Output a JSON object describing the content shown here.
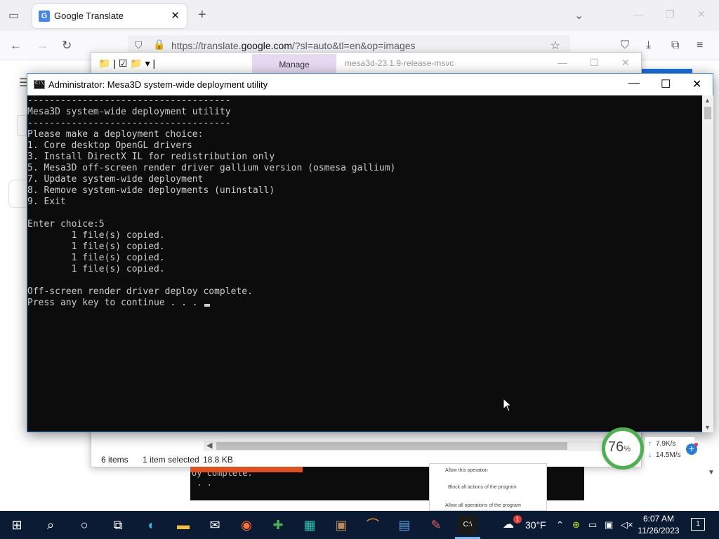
{
  "browser": {
    "tab_title": "Google Translate",
    "url_prefix": "https://translate.",
    "url_domain": "google.com",
    "url_suffix": "/?sl=auto&tl=en&op=images"
  },
  "explorer": {
    "manage_label": "Manage",
    "window_title": "mesa3d-23.1.9-release-msvc",
    "status_items": "6 items",
    "status_selected": "1 item selected",
    "status_size": "18.8 KB"
  },
  "console": {
    "title": "Administrator:  Mesa3D system-wide deployment utility",
    "lines": [
      "-------------------------------------",
      "Mesa3D system-wide deployment utility",
      "-------------------------------------",
      "Please make a deployment choice:",
      "1. Core desktop OpenGL drivers",
      "3. Install DirectX IL for redistribution only",
      "5. Mesa3D off-screen render driver gallium version (osmesa gallium)",
      "7. Update system-wide deployment",
      "8. Remove system-wide deployments (uninstall)",
      "9. Exit",
      "",
      "Enter choice:5",
      "        1 file(s) copied.",
      "        1 file(s) copied.",
      "        1 file(s) copied.",
      "        1 file(s) copied.",
      "",
      "Off-screen render driver deploy complete.",
      "Press any key to continue . . . "
    ]
  },
  "background": {
    "console_text": "oy complete.\n . . ",
    "dialog_lines": [
      "Allow this operation",
      "Block all actions of the program",
      "Allow all operations of the program"
    ]
  },
  "net_widget": {
    "percent": "76",
    "percent_unit": "%",
    "upload": "7.9K/s",
    "download": "14.5M/s"
  },
  "taskbar": {
    "weather": "30°F",
    "weather_badge": "1",
    "time": "6:07 AM",
    "date": "11/26/2023",
    "notification_count": "1"
  }
}
